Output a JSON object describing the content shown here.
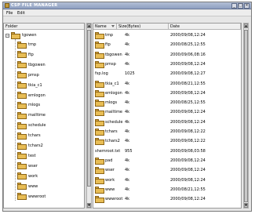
{
  "window": {
    "title": "CSP FILE MANAGER",
    "buttons": [
      "_",
      "□",
      "×"
    ]
  },
  "menu": [
    "File",
    "Edit"
  ],
  "tree": {
    "header": "Folder",
    "root": "tgowen",
    "children": [
      "tmp",
      "ftp",
      "tbgowen",
      "pmsp",
      "tkia_c1",
      "emlogon",
      "mlogs",
      "mailtime",
      "schedule",
      "tchars",
      "tchars2",
      "test",
      "wser",
      "work",
      "www",
      "wwwroot"
    ]
  },
  "files": {
    "columns": [
      "Name",
      "Size(Bytes)",
      "Date"
    ],
    "rows": [
      {
        "name": "tmp",
        "size": "4k",
        "date": "2000/09/08,12:24",
        "folder": true
      },
      {
        "name": "ftp",
        "size": "4k",
        "date": "2000/08/25,12:55",
        "folder": true
      },
      {
        "name": "tbgowen",
        "size": "4k",
        "date": "2000/09/06,08:16",
        "folder": true
      },
      {
        "name": "pmsp",
        "size": "4k",
        "date": "2000/09/08,12:24",
        "folder": true
      },
      {
        "name": "fsp.log",
        "size": "1025",
        "date": "2000/09/08,12:27",
        "folder": false
      },
      {
        "name": "tkia_c1",
        "size": "4k",
        "date": "2000/08/21,12:55",
        "folder": true
      },
      {
        "name": "emlogon",
        "size": "4k",
        "date": "2000/09/08,12:24",
        "folder": true
      },
      {
        "name": "mlogs",
        "size": "4k",
        "date": "2000/08/25,12:55",
        "folder": true
      },
      {
        "name": "mailtime",
        "size": "4k",
        "date": "2000/09/08,12:24",
        "folder": true
      },
      {
        "name": "schedule",
        "size": "4k",
        "date": "2000/09/08,12:24",
        "folder": true
      },
      {
        "name": "tchars",
        "size": "4k",
        "date": "2000/09/08,12:22",
        "folder": true
      },
      {
        "name": "tchars2",
        "size": "4k",
        "date": "2000/09/08,12:22",
        "folder": true
      },
      {
        "name": "shemroot.txt",
        "size": "955",
        "date": "2000/09/08,03:58",
        "folder": false
      },
      {
        "name": "pad",
        "size": "4k",
        "date": "2000/09/08,12:24",
        "folder": true
      },
      {
        "name": "wser",
        "size": "4k",
        "date": "2000/09/08,12:24",
        "folder": true
      },
      {
        "name": "work",
        "size": "4k",
        "date": "2000/09/08,12:24",
        "folder": true
      },
      {
        "name": "www",
        "size": "4k",
        "date": "2000/08/21,12:55",
        "folder": true
      },
      {
        "name": "wwwroot",
        "size": "4k",
        "date": "2000/09/08,12:24",
        "folder": true
      }
    ]
  }
}
